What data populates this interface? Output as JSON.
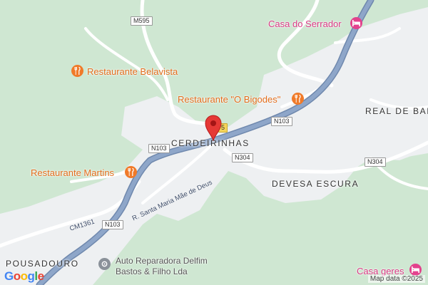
{
  "map": {
    "colors": {
      "forest": "#cfe7d2",
      "settlement": "#eef0f2",
      "main_road": "#8ea6c9",
      "minor_road": "#ffffff",
      "restaurant": "#f07a29",
      "hotel": "#e3428d",
      "pin": "#e53935"
    },
    "places": {
      "cerdeirinhas": "CERDEIRINHAS",
      "real_de_bai": "REAL DE BAI",
      "devesa_escura": "DEVESA ESCURA",
      "pousadouro": "POUSADOURO"
    },
    "pois": {
      "casa_do_serrador": {
        "label": "Casa do Serrador",
        "icon": "hotel-icon"
      },
      "restaurante_belavista": {
        "label": "Restaurante Belavista",
        "icon": "restaurant-icon"
      },
      "restaurante_o_bigodes": {
        "label": "Restaurante \"O Bigodes\"",
        "icon": "restaurant-icon"
      },
      "restaurante_martins": {
        "label": "Restaurante Martins",
        "icon": "restaurant-icon"
      },
      "auto_reparadora": {
        "line1": "Auto Reparadora Delfim",
        "line2": "Bastos & Filho Lda",
        "icon": "car-repair-icon"
      },
      "casa_geres": {
        "label": "Casa geres",
        "icon": "hotel-icon"
      }
    },
    "shields": {
      "m595": "M595",
      "n103_a": "N103",
      "n103_b": "N103",
      "n103_c": "N103",
      "n304_a": "N304",
      "n304_b": "N304",
      "route_5": "5"
    },
    "streets": {
      "santa_maria": "R. Santa Maria Mãe de Deus",
      "cm1361": "CM1361"
    },
    "brand": {
      "logo_letters": [
        "G",
        "o",
        "o",
        "g",
        "l",
        "e"
      ],
      "logo_colors": [
        "#4285F4",
        "#EA4335",
        "#FBBC05",
        "#4285F4",
        "#34A853",
        "#EA4335"
      ],
      "credit": "Map data ©2025"
    }
  }
}
